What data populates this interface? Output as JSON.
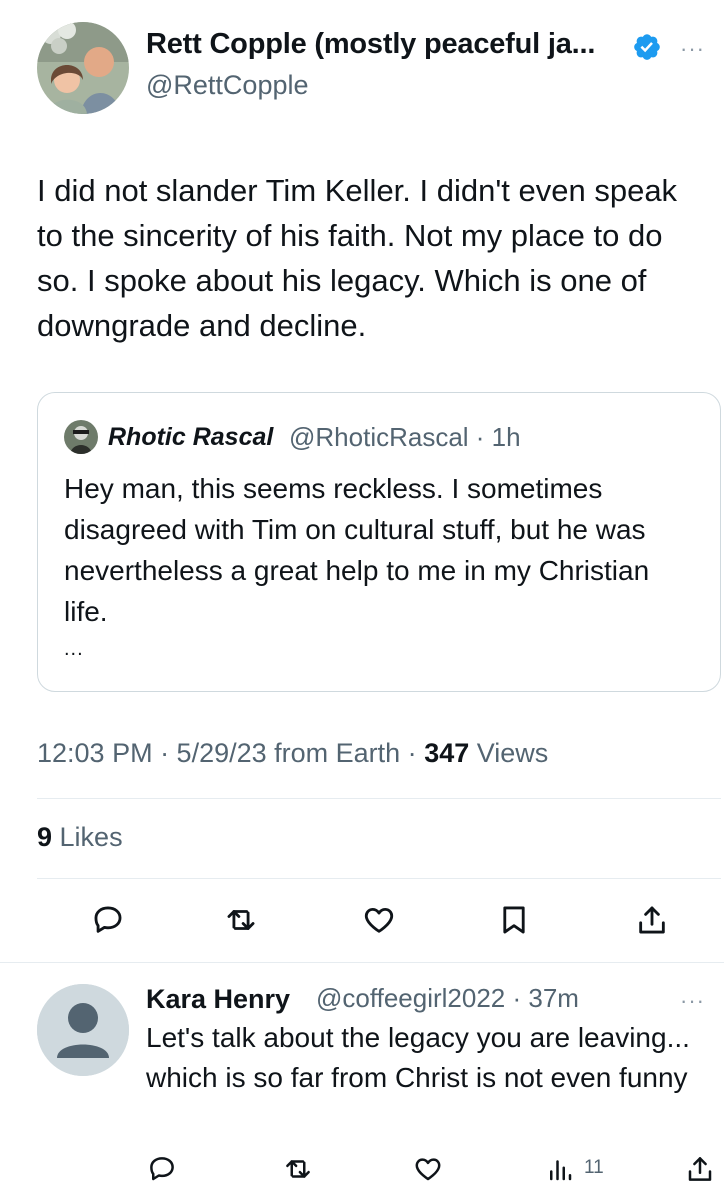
{
  "tweet": {
    "author_name": "Rett Copple (mostly peaceful ja...",
    "author_handle": "@RettCopple",
    "more": "···",
    "body": "I did not slander Tim Keller. I didn't even speak to the sincerity of his faith. Not my place to do so. I spoke about his legacy. Which is one of downgrade and decline.",
    "quote": {
      "name": "Rhotic Rascal",
      "meta": "@RhoticRascal · 1h",
      "body": "Hey man, this seems reckless. I sometimes disagreed with Tim on cultural stuff, but he was nevertheless a great help to me in my Christian life.",
      "ellipsis": "..."
    },
    "time_prefix": "12:03 PM · 5/29/23 from Earth · ",
    "views_count": "347",
    "views_label": " Views",
    "likes_count": "9",
    "likes_label": " Likes",
    "colors": {
      "accent": "#1d9bf0",
      "secondary": "#536471",
      "border": "#cfd9de"
    }
  },
  "actions": [
    "reply-icon",
    "retweet-icon",
    "like-icon",
    "bookmark-icon",
    "share-icon"
  ],
  "reply": {
    "name": "Kara Henry",
    "meta": "@coffeegirl2022 · 37m",
    "more": "···",
    "body": "Let's talk about the legacy you are leaving... which is so far from Christ is not even funny",
    "views": "11"
  }
}
